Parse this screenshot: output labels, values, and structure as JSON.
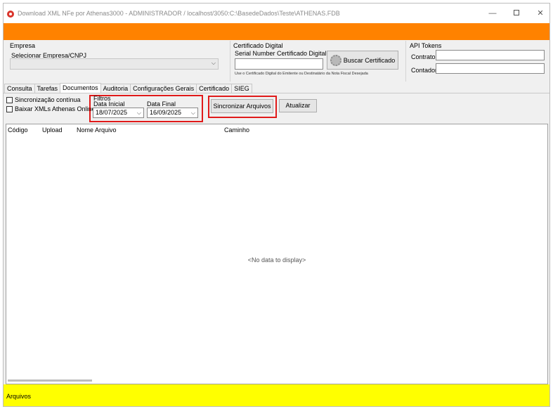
{
  "window": {
    "title": "Download XML NFe por Athenas3000  - ADMINISTRADOR / localhost/3050:C:\\BasedeDados\\Teste\\ATHENAS.FDB",
    "minimize_symbol": "—",
    "close_symbol": "✕"
  },
  "empresa": {
    "title": "Empresa",
    "select_label": "Selecionar Empresa/CNPJ",
    "select_value": ""
  },
  "certificado": {
    "title": "Certificado Digital",
    "serial_label": "Serial Number Certificado Digital",
    "serial_value": "",
    "buscar_label": "Buscar Certificado",
    "hint": "Use o Certificado Digital do Emitente ou Destinatário da Nota Fiscal Desejada"
  },
  "api_tokens": {
    "title": "API Tokens",
    "contrato_label": "Contrato",
    "contrato_value": "",
    "contador_label": "Contador",
    "contador_value": ""
  },
  "tabs": [
    {
      "label": "Consulta",
      "active": false
    },
    {
      "label": "Tarefas",
      "active": false
    },
    {
      "label": "Documentos",
      "active": true
    },
    {
      "label": "Auditoria",
      "active": false
    },
    {
      "label": "Configurações Gerais",
      "active": false
    },
    {
      "label": "Certificado",
      "active": false
    },
    {
      "label": "SIEG",
      "active": false
    }
  ],
  "documentos": {
    "sincronizacao_label": "Sincronização contínua",
    "baixar_label": "Baixar XMLs Athenas Online",
    "filtros_label": "Filtros",
    "data_inicial_label": "Data Inicial",
    "data_inicial_value": "18/07/2025",
    "data_final_label": "Data Final",
    "data_final_value": "16/09/2025",
    "sincronizar_label": "Sincronizar Arquivos",
    "atualizar_label": "Atualizar"
  },
  "grid": {
    "columns": [
      "Código",
      "Upload",
      "Nome Arquivo",
      "Caminho"
    ],
    "rows": [],
    "empty_text": "<No data to display>"
  },
  "status_bar": {
    "text": "Arquivos"
  },
  "colors": {
    "accent_orange": "#ff8200",
    "status_yellow": "#ffff00",
    "highlight_red": "#e01a1a"
  }
}
